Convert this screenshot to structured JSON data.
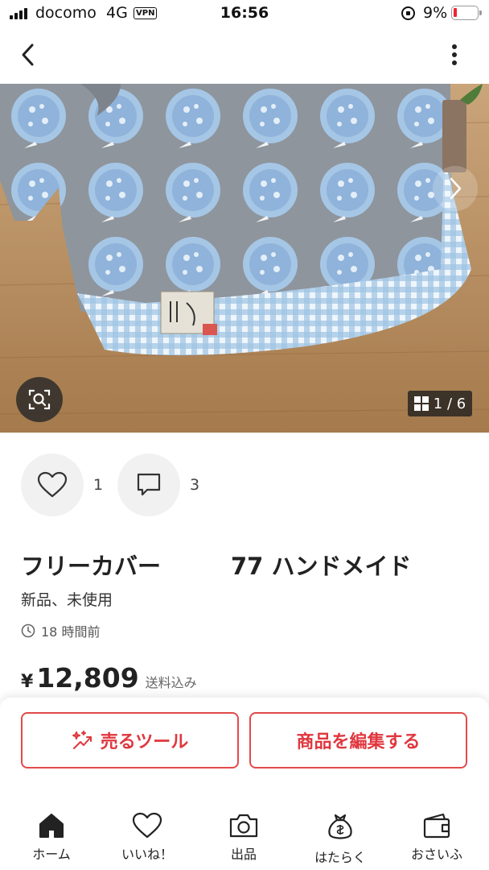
{
  "status_bar": {
    "carrier": "docomo",
    "network": "4G",
    "vpn": "VPN",
    "time": "16:56",
    "battery": "9%"
  },
  "gallery": {
    "counter": "1 / 6"
  },
  "engagement": {
    "likes": "1",
    "comments": "3"
  },
  "item": {
    "title": "フリーカバー　　　77 ハンドメイド",
    "condition": "新品、未使用",
    "posted": "18 時間前",
    "currency": "¥",
    "price": "12,809",
    "shipping": "送料込み"
  },
  "actions": {
    "sell_tool": "売るツール",
    "edit_item": "商品を編集する"
  },
  "tabs": [
    {
      "label": "ホーム",
      "icon": "home-icon"
    },
    {
      "label": "いいね！",
      "icon": "heart-icon"
    },
    {
      "label": "出品",
      "icon": "camera-icon"
    },
    {
      "label": "はたらく",
      "icon": "money-bag-icon"
    },
    {
      "label": "おさいふ",
      "icon": "wallet-icon"
    }
  ],
  "colors": {
    "accent": "#e0373e",
    "text": "#222222"
  }
}
